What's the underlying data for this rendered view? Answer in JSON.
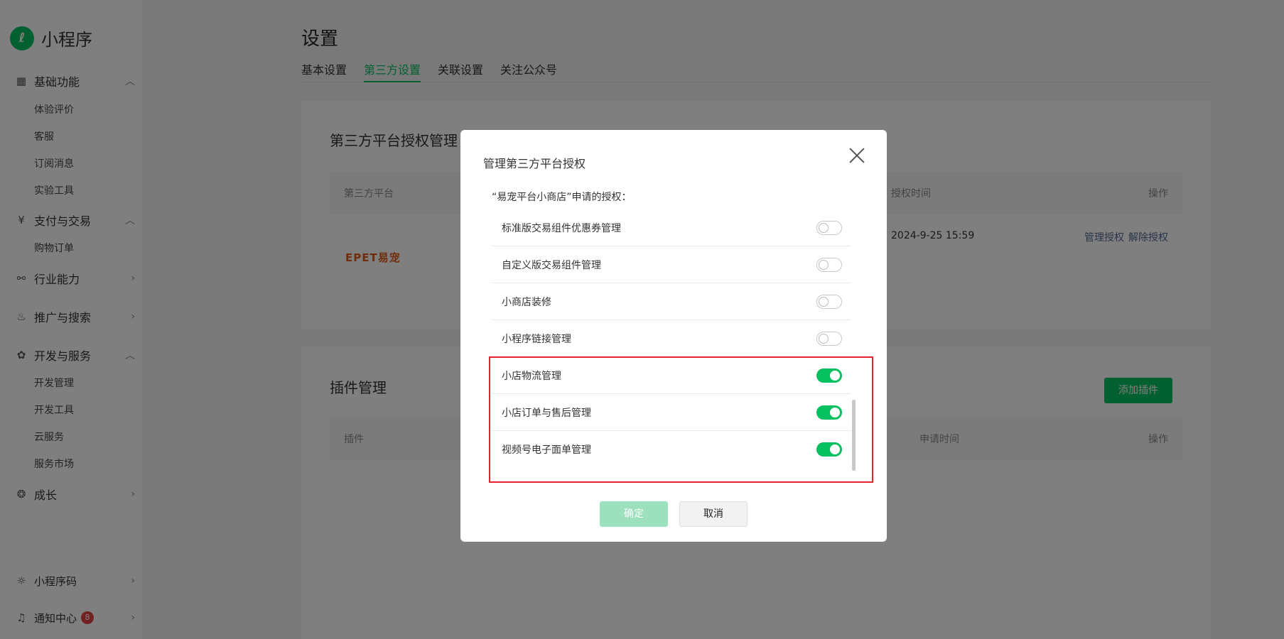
{
  "sidebar": {
    "logo": "小程序",
    "groups": [
      {
        "label": "基础功能",
        "icon": "grid-icon",
        "expanded": true,
        "items": [
          "体验评价",
          "客服",
          "订阅消息",
          "实验工具"
        ]
      },
      {
        "label": "支付与交易",
        "icon": "yuan-icon",
        "expanded": true,
        "items": [
          "购物订单"
        ]
      },
      {
        "label": "行业能力",
        "icon": "industry-icon",
        "expanded": false
      },
      {
        "label": "推广与搜索",
        "icon": "flame-icon",
        "expanded": false
      },
      {
        "label": "开发与服务",
        "icon": "dev-icon",
        "expanded": true,
        "items": [
          "开发管理",
          "开发工具",
          "云服务",
          "服务市场"
        ]
      },
      {
        "label": "成长",
        "icon": "growth-icon",
        "expanded": false
      }
    ],
    "bottom": [
      {
        "label": "小程序码",
        "icon": "sun-icon"
      },
      {
        "label": "通知中心",
        "icon": "bell-icon",
        "badge": "8"
      }
    ]
  },
  "main": {
    "title": "设置",
    "tabs": [
      "基本设置",
      "第三方设置",
      "关联设置",
      "关注公众号"
    ],
    "active_tab": 1,
    "third_party": {
      "title": "第三方平台授权管理",
      "columns": [
        "第三方平台",
        "授权时间",
        "操作"
      ],
      "row": {
        "platform_logo": "EPET易宠",
        "time": "2024-9-25 15:59",
        "actions": [
          "管理授权",
          "解除授权"
        ]
      }
    },
    "plugins": {
      "title": "插件管理",
      "add_label": "添加插件",
      "columns": [
        "插件",
        "申请时间",
        "操作"
      ]
    }
  },
  "dialog": {
    "title": "管理第三方平台授权",
    "desc": "“易宠平台小商店”申请的授权：",
    "permissions": [
      {
        "label": "标准版交易组件优惠券管理",
        "on": false
      },
      {
        "label": "自定义版交易组件管理",
        "on": false
      },
      {
        "label": "小商店装修",
        "on": false
      },
      {
        "label": "小程序链接管理",
        "on": false
      },
      {
        "label": "小店物流管理",
        "on": true
      },
      {
        "label": "小店订单与售后管理",
        "on": true
      },
      {
        "label": "视频号电子面单管理",
        "on": true
      }
    ],
    "ok_label": "确定",
    "cancel_label": "取消"
  },
  "colors": {
    "accent": "#07c160",
    "highlight": "#e5232e",
    "link": "#576b95"
  }
}
